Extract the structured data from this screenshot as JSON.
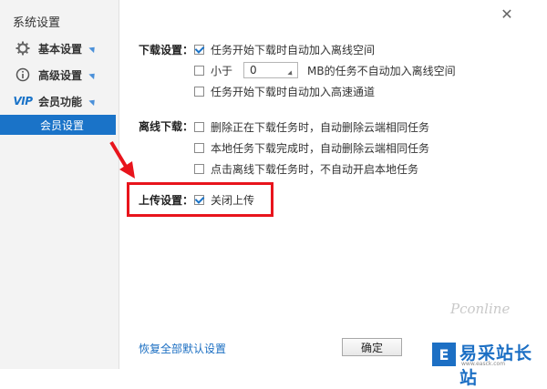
{
  "window": {
    "title": "系统设置",
    "close_icon": "close-icon"
  },
  "sidebar": {
    "items": [
      {
        "label": "基本设置",
        "icon": "gear-icon"
      },
      {
        "label": "高级设置",
        "icon": "info-icon"
      },
      {
        "label": "会员功能",
        "icon": "vip-icon",
        "badge": "VIP"
      }
    ],
    "sub_item": "会员设置"
  },
  "download": {
    "label": "下载设置：",
    "opt1": "任务开始下载时自动加入离线空间",
    "opt1_checked": true,
    "opt2_prefix": "小于",
    "opt2_value": "0",
    "opt2_suffix": "MB的任务不自动加入离线空间",
    "opt2_checked": false,
    "opt3": "任务开始下载时自动加入高速通道",
    "opt3_checked": false
  },
  "offline": {
    "label": "离线下载：",
    "opt1": "删除正在下载任务时，自动删除云端相同任务",
    "opt2": "本地任务下载完成时，自动删除云端相同任务",
    "opt3": "点击离线下载任务时，不自动开启本地任务"
  },
  "upload": {
    "label": "上传设置：",
    "opt1": "关闭上传",
    "opt1_checked": true
  },
  "footer": {
    "restore_link": "恢复全部默认设置",
    "ok_button": "确定"
  },
  "watermark": {
    "pconline": "Pconline",
    "site_name": "易采站长站",
    "site_sub": "www.easck.com"
  },
  "colors": {
    "accent": "#1a73c8",
    "highlight": "#e8141c"
  }
}
